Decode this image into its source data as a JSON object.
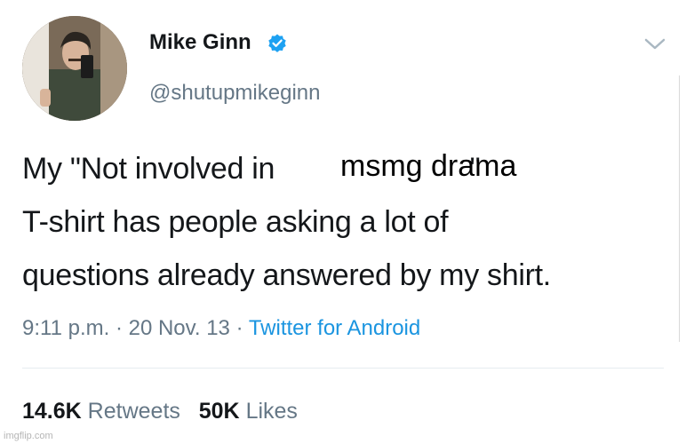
{
  "author": {
    "display_name": "Mike Ginn",
    "handle": "@shutupmikeginn",
    "avatar_icon": "profile-photo",
    "verified_icon": "verified-badge-icon",
    "verified_color": "#1da1f2"
  },
  "tweet": {
    "line1": "My \"Not involved in                        \"",
    "line2": "T-shirt has people asking a lot of",
    "line3": "questions already answered by my shirt.",
    "overlay_text": "msmg drama"
  },
  "meta": {
    "time": "9:11 p.m.",
    "separator1": " · ",
    "date": "20 Nov. 13",
    "separator2": " · ",
    "source": "Twitter for Android",
    "source_color": "#1b95e0"
  },
  "stats": {
    "retweets_count": "14.6K",
    "retweets_label": "Retweets",
    "likes_count": "50K",
    "likes_label": "Likes"
  },
  "watermark": "imgflip.com",
  "caret_icon": "chevron-down-icon"
}
